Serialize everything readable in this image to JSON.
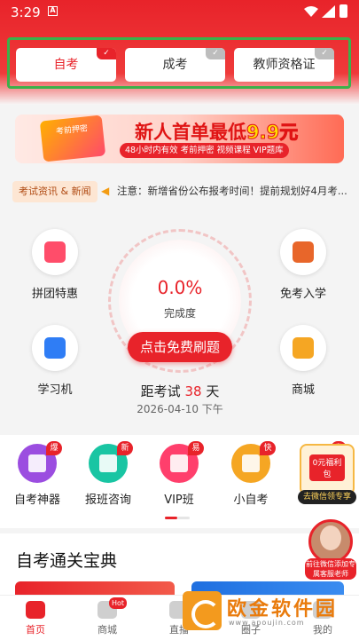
{
  "status_bar": {
    "time": "3:29",
    "notification_icon": "A"
  },
  "exam_types": [
    {
      "label": "自考",
      "active": true
    },
    {
      "label": "成考",
      "active": false
    },
    {
      "label": "教师资格证",
      "active": false
    }
  ],
  "banner": {
    "book_label": "考前押密",
    "title_prefix": "新人首单最低",
    "title_price": "9.9元",
    "subtitle": "48小时内有效  考前押密 视频课程 VIP题库"
  },
  "news": {
    "tag": "考试资讯 & 新闻",
    "text": "注意：新增省份公布报考时间！提前规划好4月考..."
  },
  "left_items": [
    {
      "label": "拼团特惠",
      "icon": "shopping-bag-icon",
      "color": "#ff4d6a"
    },
    {
      "label": "学习机",
      "icon": "home-icon",
      "color": "#2f7df5"
    }
  ],
  "right_items": [
    {
      "label": "免考入学",
      "icon": "bank-icon",
      "color": "#e8662a"
    },
    {
      "label": "商城",
      "icon": "shopping-bag-icon",
      "color": "#f5a623"
    }
  ],
  "progress": {
    "percent": "0.0%",
    "value": 0.0,
    "label": "完成度",
    "button": "点击免费刷题"
  },
  "countdown": {
    "prefix": "距考试",
    "days": "38",
    "suffix": "天",
    "date": "2026-04-10 下午"
  },
  "quick_items": [
    {
      "label": "自考神器",
      "badge": "爆",
      "icon": "book-icon",
      "color": "#9b4de0"
    },
    {
      "label": "报班咨询",
      "badge": "新",
      "icon": "chat-icon",
      "color": "#19c5a3"
    },
    {
      "label": "VIP班",
      "badge": "易",
      "icon": "graduation-cap-icon",
      "color": "#ff3f6c"
    },
    {
      "label": "小自考",
      "badge": "快",
      "icon": "document-icon",
      "color": "#f5a623"
    },
    {
      "label": "去微信领专享",
      "badge": "省",
      "icon": "gift-icon",
      "color": "#2f7df5"
    }
  ],
  "promo_float": {
    "tag": "0元福利包",
    "caption": "去微信领专享"
  },
  "advisor_float": {
    "caption": "前往微信添加专属客服老师"
  },
  "guide": {
    "title": "自考通关宝典"
  },
  "tabbar": [
    {
      "label": "首页",
      "icon": "home-icon",
      "active": true,
      "badge": ""
    },
    {
      "label": "商城",
      "icon": "shopping-bag-icon",
      "active": false,
      "badge": "Hot"
    },
    {
      "label": "直播",
      "icon": "play-icon",
      "active": false,
      "badge": ""
    },
    {
      "label": "圈子",
      "icon": "circle-icon",
      "active": false,
      "badge": ""
    },
    {
      "label": "我的",
      "icon": "user-icon",
      "active": false,
      "badge": ""
    }
  ],
  "watermark": {
    "name": "欧金软件园",
    "url": "www.apoujin.com"
  },
  "colors": {
    "brand": "#e8232a",
    "highlight": "#3bb14a"
  }
}
